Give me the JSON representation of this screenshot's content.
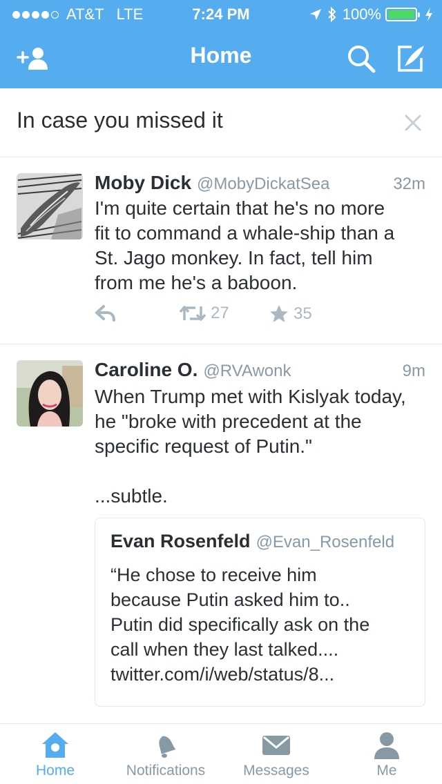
{
  "status_bar": {
    "carrier": "AT&T",
    "network": "LTE",
    "time": "7:24 PM",
    "battery": "100%",
    "signal_bars": 4
  },
  "nav": {
    "title": "Home",
    "left_icon": "add-user-icon",
    "right_icons": [
      "search-icon",
      "compose-icon"
    ]
  },
  "banner": {
    "title": "In case you missed it",
    "close_icon": "close-icon"
  },
  "tweets": [
    {
      "name": "Moby Dick",
      "handle": "@MobyDickatSea",
      "time": "32m",
      "text": "I'm quite certain that he's no more\nfit to command a whale-ship than a\nSt. Jago monkey. In fact, tell him\nfrom me he's a baboon.",
      "retweets": "27",
      "likes": "35"
    },
    {
      "name": "Caroline O.",
      "handle": "@RVAwonk",
      "time": "9m",
      "text": "When Trump met with Kislyak today,\nhe \"broke with precedent at the\nspecific request of Putin.\"\n\n...subtle.",
      "quote": {
        "name": "Evan Rosenfeld",
        "handle": "@Evan_Rosenfeld",
        "text": "“He chose to receive him\nbecause Putin asked him to..\nPutin did specifically ask on the\ncall when they last talked....\ntwitter.com/i/web/status/8..."
      }
    }
  ],
  "tabs": [
    {
      "label": "Home",
      "icon": "home-icon",
      "active": true
    },
    {
      "label": "Notifications",
      "icon": "bell-icon",
      "active": false
    },
    {
      "label": "Messages",
      "icon": "envelope-icon",
      "active": false
    },
    {
      "label": "Me",
      "icon": "person-icon",
      "active": false
    }
  ],
  "colors": {
    "brand": "#55acee",
    "text": "#292f33",
    "muted": "#8899a6",
    "battery": "#4cd964"
  }
}
